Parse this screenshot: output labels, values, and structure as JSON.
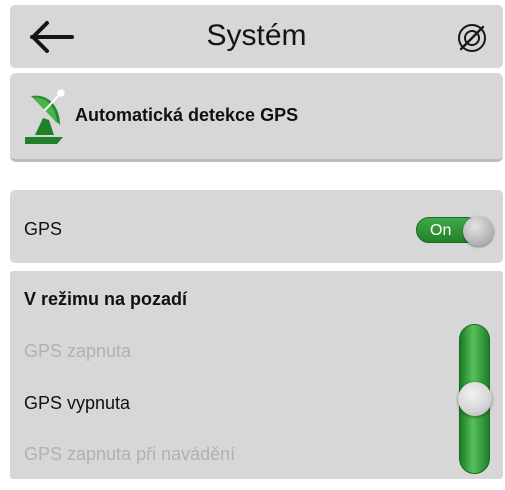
{
  "header": {
    "title": "Systém",
    "back_icon": "arrow-left-icon",
    "gps_off_icon": "crossed-circle-icon"
  },
  "auto_detect": {
    "label": "Automatická detekce GPS",
    "icon": "satellite-dish-icon"
  },
  "gps": {
    "label": "GPS",
    "toggle_label": "On",
    "state": true,
    "accent": "#2e9637"
  },
  "background_mode": {
    "title": "V režimu na pozadí",
    "options": [
      {
        "label": "GPS zapnuta",
        "selected": false
      },
      {
        "label": "GPS vypnuta",
        "selected": true
      },
      {
        "label": "GPS zapnuta při navádění",
        "selected": false
      }
    ],
    "selected_index": 1
  },
  "colors": {
    "panel_background": "#d7d7d7",
    "toggle_green": "#2e9637",
    "slider_green": "#25892f",
    "inactive_text": "#b1b1b1",
    "active_text": "#111111"
  }
}
